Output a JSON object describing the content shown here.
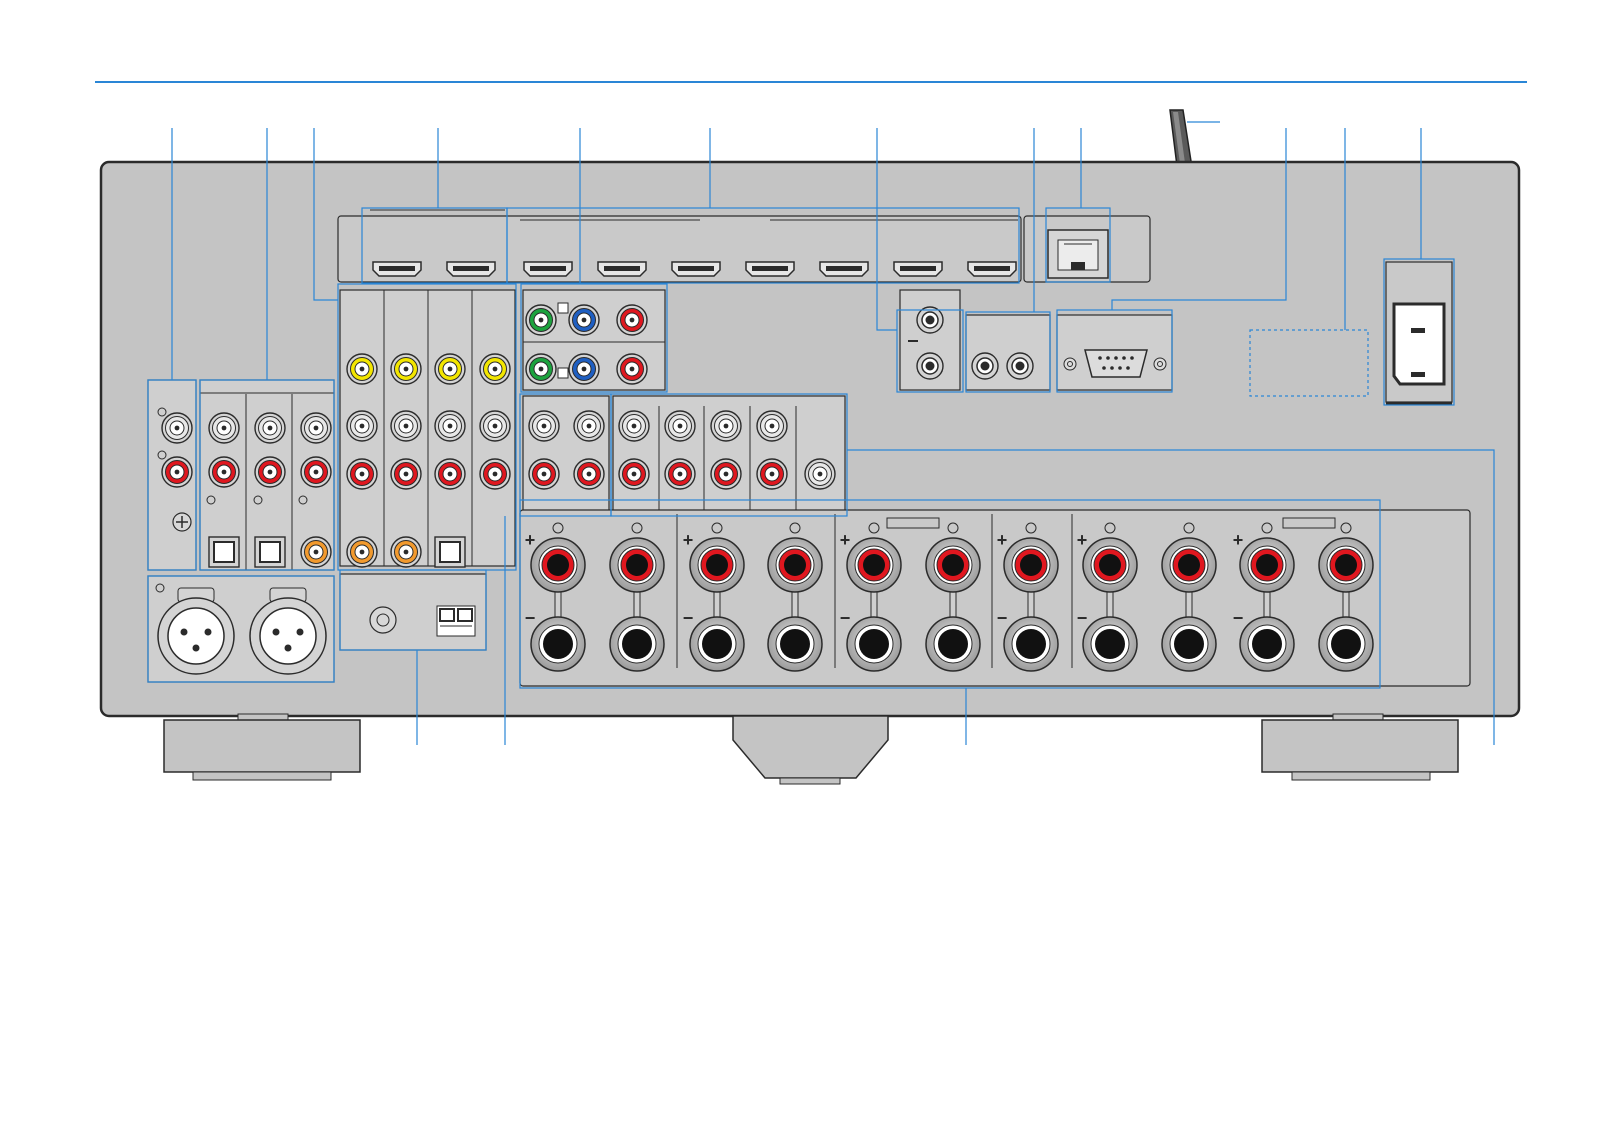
{
  "diagram": {
    "polarity_plus": "+",
    "polarity_minus": "−"
  },
  "colors": {
    "callout": "#2a86d6",
    "panel": "#c4c4c4",
    "panel_edge": "#2b2b2b",
    "inner": "#cfcfcf",
    "jack_red": "#e0171f",
    "jack_white": "#e8e8e8",
    "jack_yellow": "#f3e600",
    "jack_orange": "#f29a2e",
    "jack_green": "#1ca33e",
    "jack_blue": "#1f5fc2"
  }
}
